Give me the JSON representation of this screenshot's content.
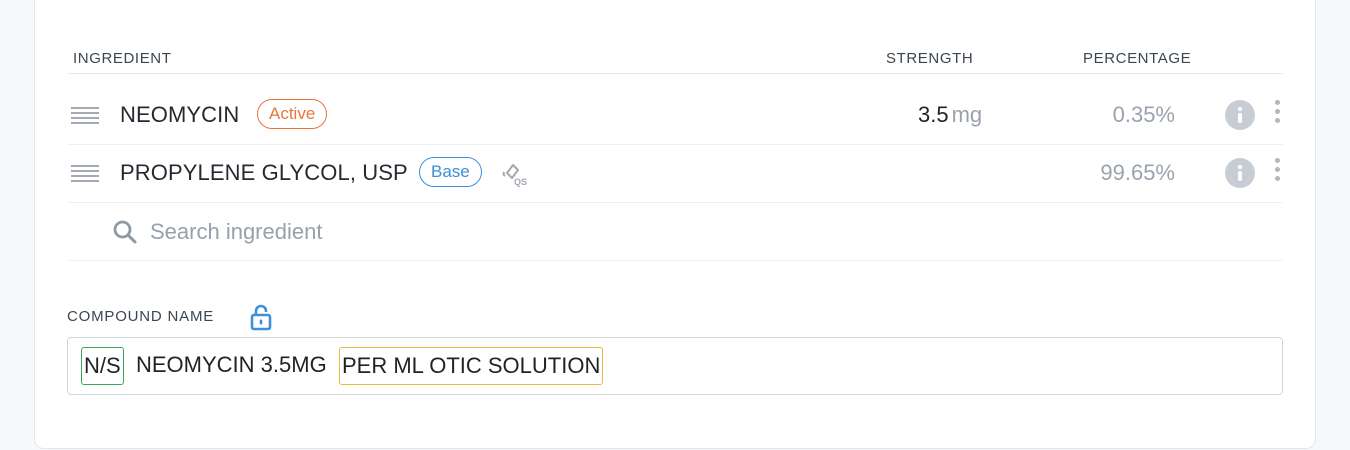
{
  "table": {
    "headers": {
      "ingredient": "INGREDIENT",
      "strength": "STRENGTH",
      "percentage": "PERCENTAGE"
    },
    "rows": [
      {
        "name": "NEOMYCIN",
        "badge": "Active",
        "strength_value": "3.5",
        "strength_unit": "mg",
        "percentage": "0.35%"
      },
      {
        "name": "PROPYLENE GLYCOL, USP",
        "badge": "Base",
        "strength_value": "",
        "strength_unit": "",
        "percentage": "99.65%",
        "qs_icon": "qs-icon"
      }
    ],
    "search": {
      "placeholder": "Search ingredient",
      "value": ""
    }
  },
  "compound": {
    "label": "COMPOUND NAME",
    "lock_icon": "lock-open-icon",
    "segments": {
      "prefix": "N/S",
      "main": "NEOMYCIN 3.5MG",
      "sig": "PER ML OTIC SOLUTION"
    }
  },
  "colors": {
    "active_badge": "#e7773a",
    "base_badge": "#3d8fd8",
    "prefix_outline": "#3ba55c",
    "sig_outline": "#e9b940",
    "lock_icon": "#3d8fd8",
    "muted_text": "#9aa3ad"
  }
}
